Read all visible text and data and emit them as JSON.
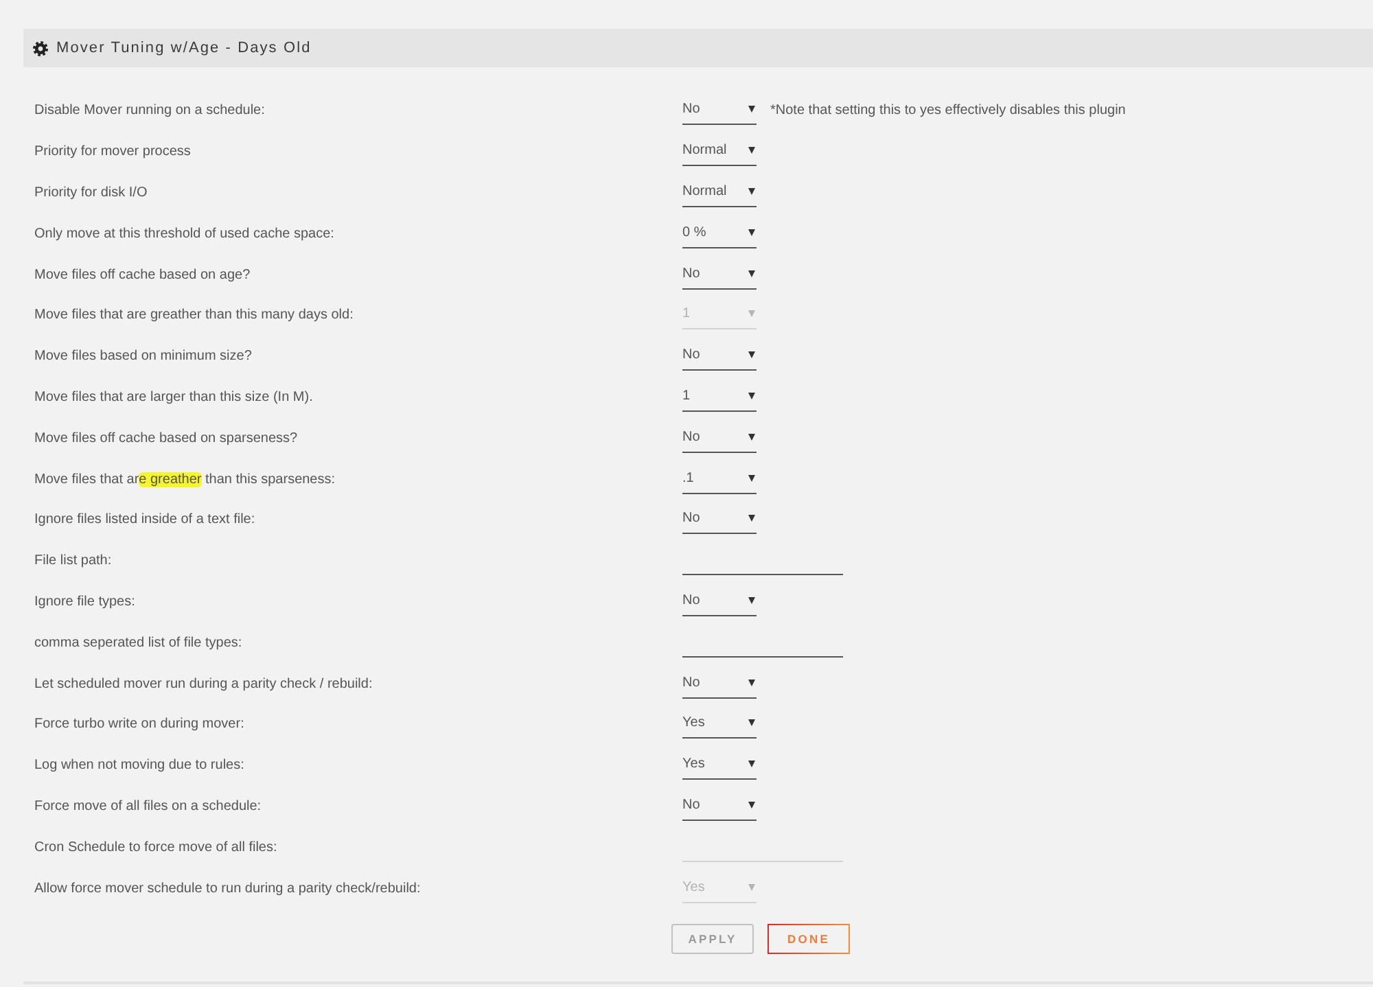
{
  "section": {
    "title": "Mover Tuning w/Age - Days Old"
  },
  "settings": [
    {
      "label": "Disable Mover running on a schedule:",
      "kind": "select",
      "value": "No",
      "disabled": false,
      "note": "*Note that setting this to yes effectively disables this plugin"
    },
    {
      "label": "Priority for mover process",
      "kind": "select",
      "value": "Normal",
      "disabled": false
    },
    {
      "label": "Priority for disk I/O",
      "kind": "select",
      "value": "Normal",
      "disabled": false
    },
    {
      "label": "Only move at this threshold of used cache space:",
      "kind": "select",
      "value": "0 %",
      "disabled": false
    },
    {
      "label": "Move files off cache based on age?",
      "kind": "select",
      "value": "No",
      "disabled": false
    },
    {
      "label": "Move files that are greather than this many days old:",
      "kind": "select",
      "value": "1",
      "disabled": true
    },
    {
      "label": "Move files based on minimum size?",
      "kind": "select",
      "value": "No",
      "disabled": false
    },
    {
      "label": "Move files that are larger than this size (In M).",
      "kind": "select",
      "value": "1",
      "disabled": false
    },
    {
      "label": "Move files off cache based on sparseness?",
      "kind": "select",
      "value": "No",
      "disabled": false
    },
    {
      "label_parts": [
        {
          "text": "Move files that ar",
          "highlighted": false
        },
        {
          "text": "e greather",
          "highlighted": true
        },
        {
          "text": " than this sparseness:",
          "highlighted": false
        }
      ],
      "kind": "select",
      "value": ".1",
      "disabled": false
    },
    {
      "label": "Ignore files listed inside of a text file:",
      "kind": "select",
      "value": "No",
      "disabled": false
    },
    {
      "label": "File list path:",
      "kind": "text",
      "disabled": false
    },
    {
      "label": "Ignore file types:",
      "kind": "select",
      "value": "No",
      "disabled": false
    },
    {
      "label": "comma seperated list of file types:",
      "kind": "text",
      "disabled": false
    },
    {
      "label": "Let scheduled mover run during a parity check / rebuild:",
      "kind": "select",
      "value": "No",
      "disabled": false
    },
    {
      "label": "Force turbo write on during mover:",
      "kind": "select",
      "value": "Yes",
      "disabled": false
    },
    {
      "label": "Log when not moving due to rules:",
      "kind": "select",
      "value": "Yes",
      "disabled": false
    },
    {
      "label": "Force move of all files on a schedule:",
      "kind": "select",
      "value": "No",
      "disabled": false
    },
    {
      "label": "Cron Schedule to force move of all files:",
      "kind": "text",
      "disabled": true
    },
    {
      "label": "Allow force mover schedule to run during a parity check/rebuild:",
      "kind": "select",
      "value": "Yes",
      "disabled": true
    }
  ],
  "buttons": [
    {
      "label": "APPLY",
      "kind": "secondary",
      "disabled": true
    },
    {
      "label": "DONE",
      "kind": "primary",
      "disabled": false
    }
  ]
}
